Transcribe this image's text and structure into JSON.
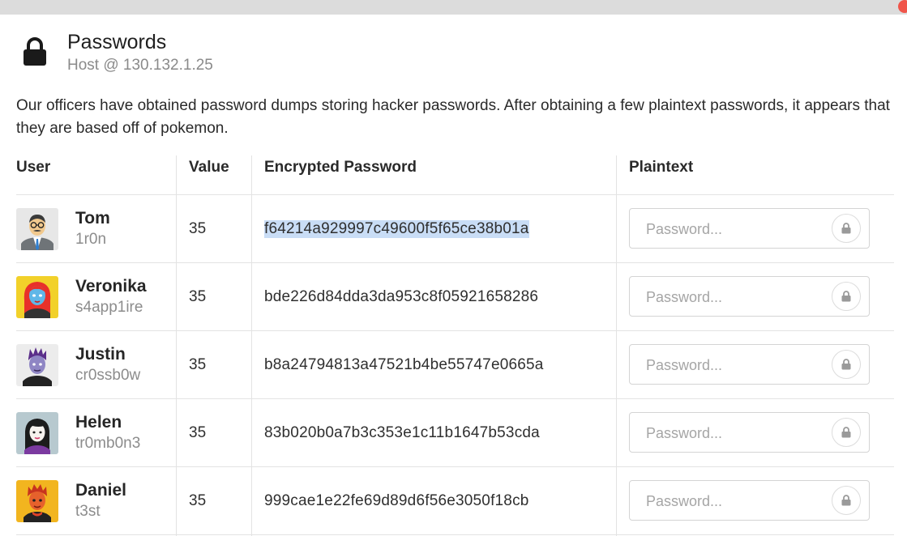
{
  "window": {
    "close_color": "#f0554a"
  },
  "header": {
    "icon": "lock-icon",
    "title": "Passwords",
    "subtitle": "Host @ 130.132.1.25"
  },
  "description": "Our officers have obtained password dumps storing hacker passwords. After obtaining a few plaintext passwords, it appears that they are based off of pokemon.",
  "table": {
    "columns": [
      "User",
      "Value",
      "Encrypted Password",
      "Plaintext"
    ],
    "placeholder": "Password...",
    "rows": [
      {
        "name": "Tom",
        "handle": "1r0n",
        "value": "35",
        "hash": "f64214a929997c49600f5f65ce38b01a",
        "avatar": "man-with-glasses-and-tie-avatar",
        "selected": true
      },
      {
        "name": "Veronika",
        "handle": "s4app1ire",
        "value": "35",
        "hash": "bde226d84dda3da953c8f05921658286",
        "avatar": "red-haired-woman-avatar"
      },
      {
        "name": "Justin",
        "handle": "cr0ssb0w",
        "value": "35",
        "hash": "b8a24794813a47521b4be55747e0665a",
        "avatar": "purple-haired-man-avatar"
      },
      {
        "name": "Helen",
        "handle": "tr0mb0n3",
        "value": "35",
        "hash": "83b020b0a7b3c353e1c11b1647b53cda",
        "avatar": "dark-haired-woman-avatar"
      },
      {
        "name": "Daniel",
        "handle": "t3st",
        "value": "35",
        "hash": "999cae1e22fe69d89d6f56e3050f18cb",
        "avatar": "orange-haired-man-avatar"
      }
    ]
  }
}
